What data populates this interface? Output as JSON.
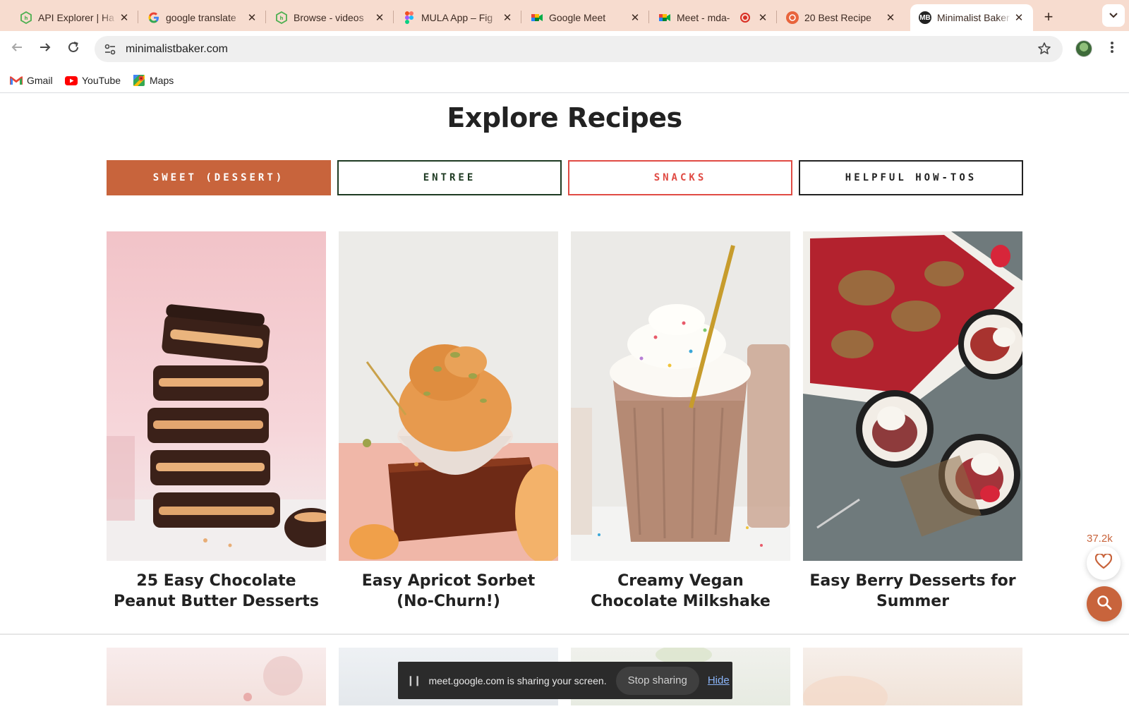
{
  "browser": {
    "tabs": [
      {
        "title": "API Explorer | Ha",
        "icon": "hatch-icon"
      },
      {
        "title": "google translate",
        "icon": "google-icon"
      },
      {
        "title": "Browse - videos",
        "icon": "hatch-icon"
      },
      {
        "title": "MULA App – Fig",
        "icon": "figma-icon"
      },
      {
        "title": "Google Meet",
        "icon": "meet-icon"
      },
      {
        "title": "Meet - mda-",
        "icon": "meet-icon"
      },
      {
        "title": "20 Best Recipe",
        "icon": "recipe-icon"
      },
      {
        "title": "Minimalist Baker",
        "icon": "minimalist-baker-icon"
      }
    ],
    "url": "minimalistbaker.com",
    "bookmarks": [
      {
        "label": "Gmail",
        "icon": "gmail-icon"
      },
      {
        "label": "YouTube",
        "icon": "youtube-icon"
      },
      {
        "label": "Maps",
        "icon": "maps-icon"
      }
    ]
  },
  "page": {
    "title": "Explore Recipes",
    "categories": [
      {
        "label": "SWEET (DESSERT)",
        "color": "#c8643c"
      },
      {
        "label": "ENTREE",
        "color": "#1e3a22"
      },
      {
        "label": "SNACKS",
        "color": "#e04b44"
      },
      {
        "label": "HELPFUL HOW-TOS",
        "color": "#222222"
      }
    ],
    "recipes": [
      {
        "title": "25 Easy Chocolate Peanut Butter Desserts"
      },
      {
        "title": "Easy Apricot Sorbet (No-Churn!)"
      },
      {
        "title": "Creamy Vegan Chocolate Milkshake"
      },
      {
        "title": "Easy Berry Desserts for Summer"
      }
    ],
    "favorites_count": "37.2k",
    "accent_color": "#c8643c"
  },
  "share_bar": {
    "message": "meet.google.com is sharing your screen.",
    "stop_label": "Stop sharing",
    "hide_label": "Hide"
  }
}
